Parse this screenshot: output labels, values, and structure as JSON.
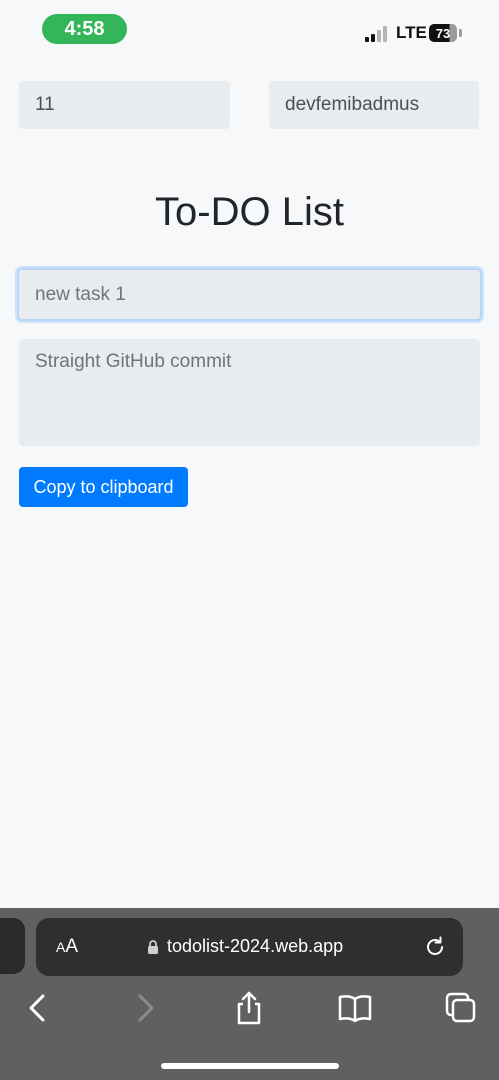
{
  "status_bar": {
    "time": "4:58",
    "network": "LTE",
    "battery_level": "73",
    "battery_fraction": 0.73,
    "time_pill_color": "#34b55a"
  },
  "form": {
    "field_one_value": "11",
    "field_two_value": "devfemibadmus",
    "title": "To-DO List",
    "task_placeholder": "new task 1",
    "description_placeholder": "Straight GitHub commit",
    "copy_button_label": "Copy to clipboard",
    "accent_color": "#007bff"
  },
  "browser": {
    "text_size_label_small": "A",
    "text_size_label_large": "A",
    "url": "todolist-2024.web.app",
    "icons": [
      "lock-icon",
      "reload-icon",
      "back-icon",
      "forward-icon",
      "share-icon",
      "bookmarks-icon",
      "tabs-icon"
    ]
  }
}
